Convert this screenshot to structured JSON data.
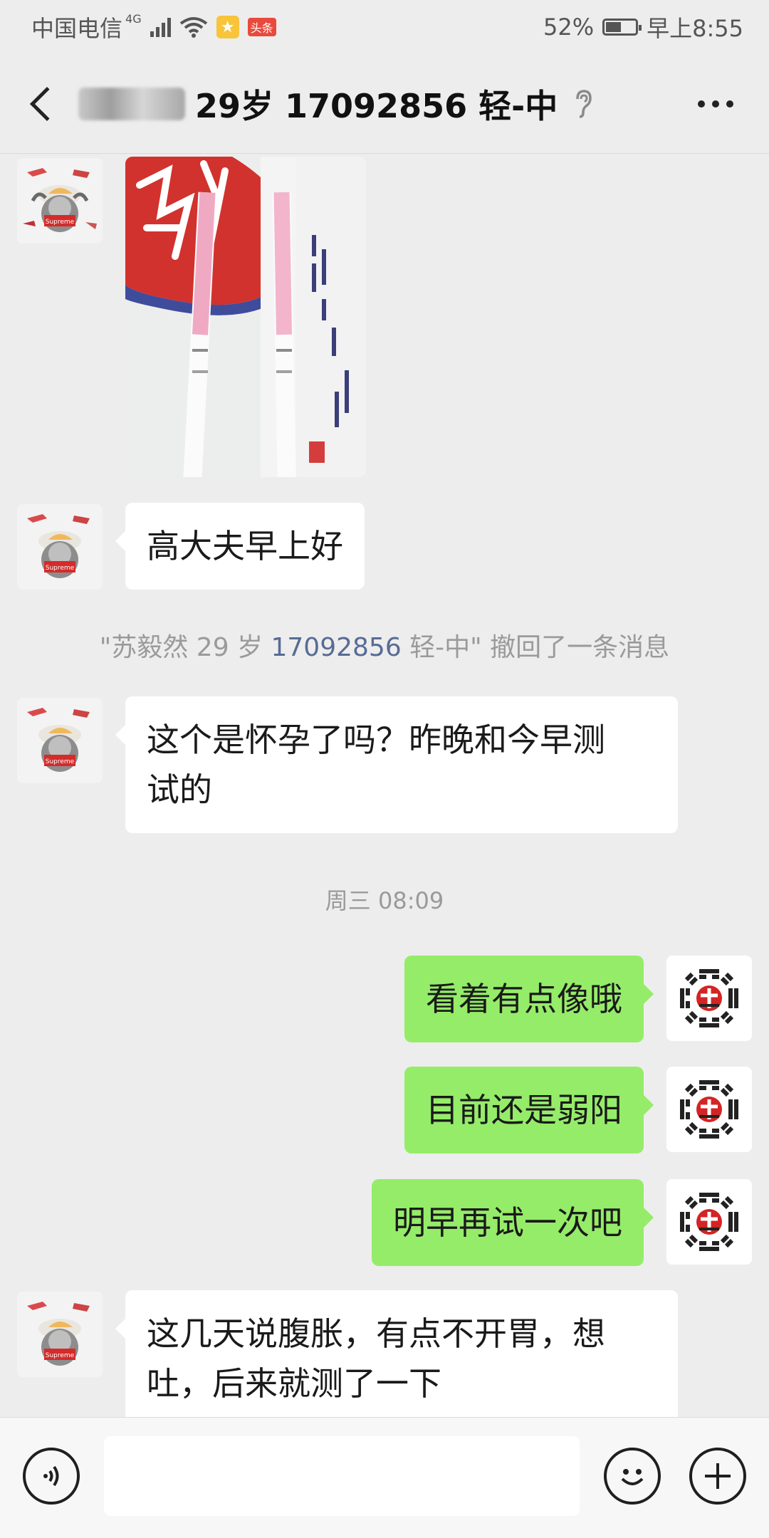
{
  "status_bar": {
    "carrier": "中国电信",
    "network": "4G",
    "news_badge": "头条",
    "battery": "52%",
    "battery_level": 0.52,
    "time": "早上8:55"
  },
  "header": {
    "title": "29岁 17092856 轻-中"
  },
  "messages": [
    {
      "side": "left",
      "type": "image"
    },
    {
      "side": "left",
      "text": "高大夫早上好"
    },
    {
      "type": "recall",
      "quote_open": "\"苏毅然 29 岁 ",
      "number": "17092856",
      "quote_close": " 轻-中\"",
      "action": " 撤回了一条消息"
    },
    {
      "side": "left",
      "text_lines": [
        "这个是怀孕了吗？昨晚和今早测",
        "试的"
      ]
    },
    {
      "type": "time",
      "text": "周三 08:09"
    },
    {
      "side": "right",
      "text": "看着有点像哦"
    },
    {
      "side": "right",
      "text": "目前还是弱阳"
    },
    {
      "side": "right",
      "text": "明早再试一次吧"
    },
    {
      "side": "left",
      "text_lines": [
        "这几天说腹胀，有点不开胃，想",
        "吐，后来就测了一下"
      ]
    }
  ],
  "avatar_left": {
    "caption": "Supreme"
  },
  "colors": {
    "background": "#ededed",
    "bubble_right": "#95ec69",
    "bubble_left": "#ffffff",
    "link": "#576b95"
  }
}
